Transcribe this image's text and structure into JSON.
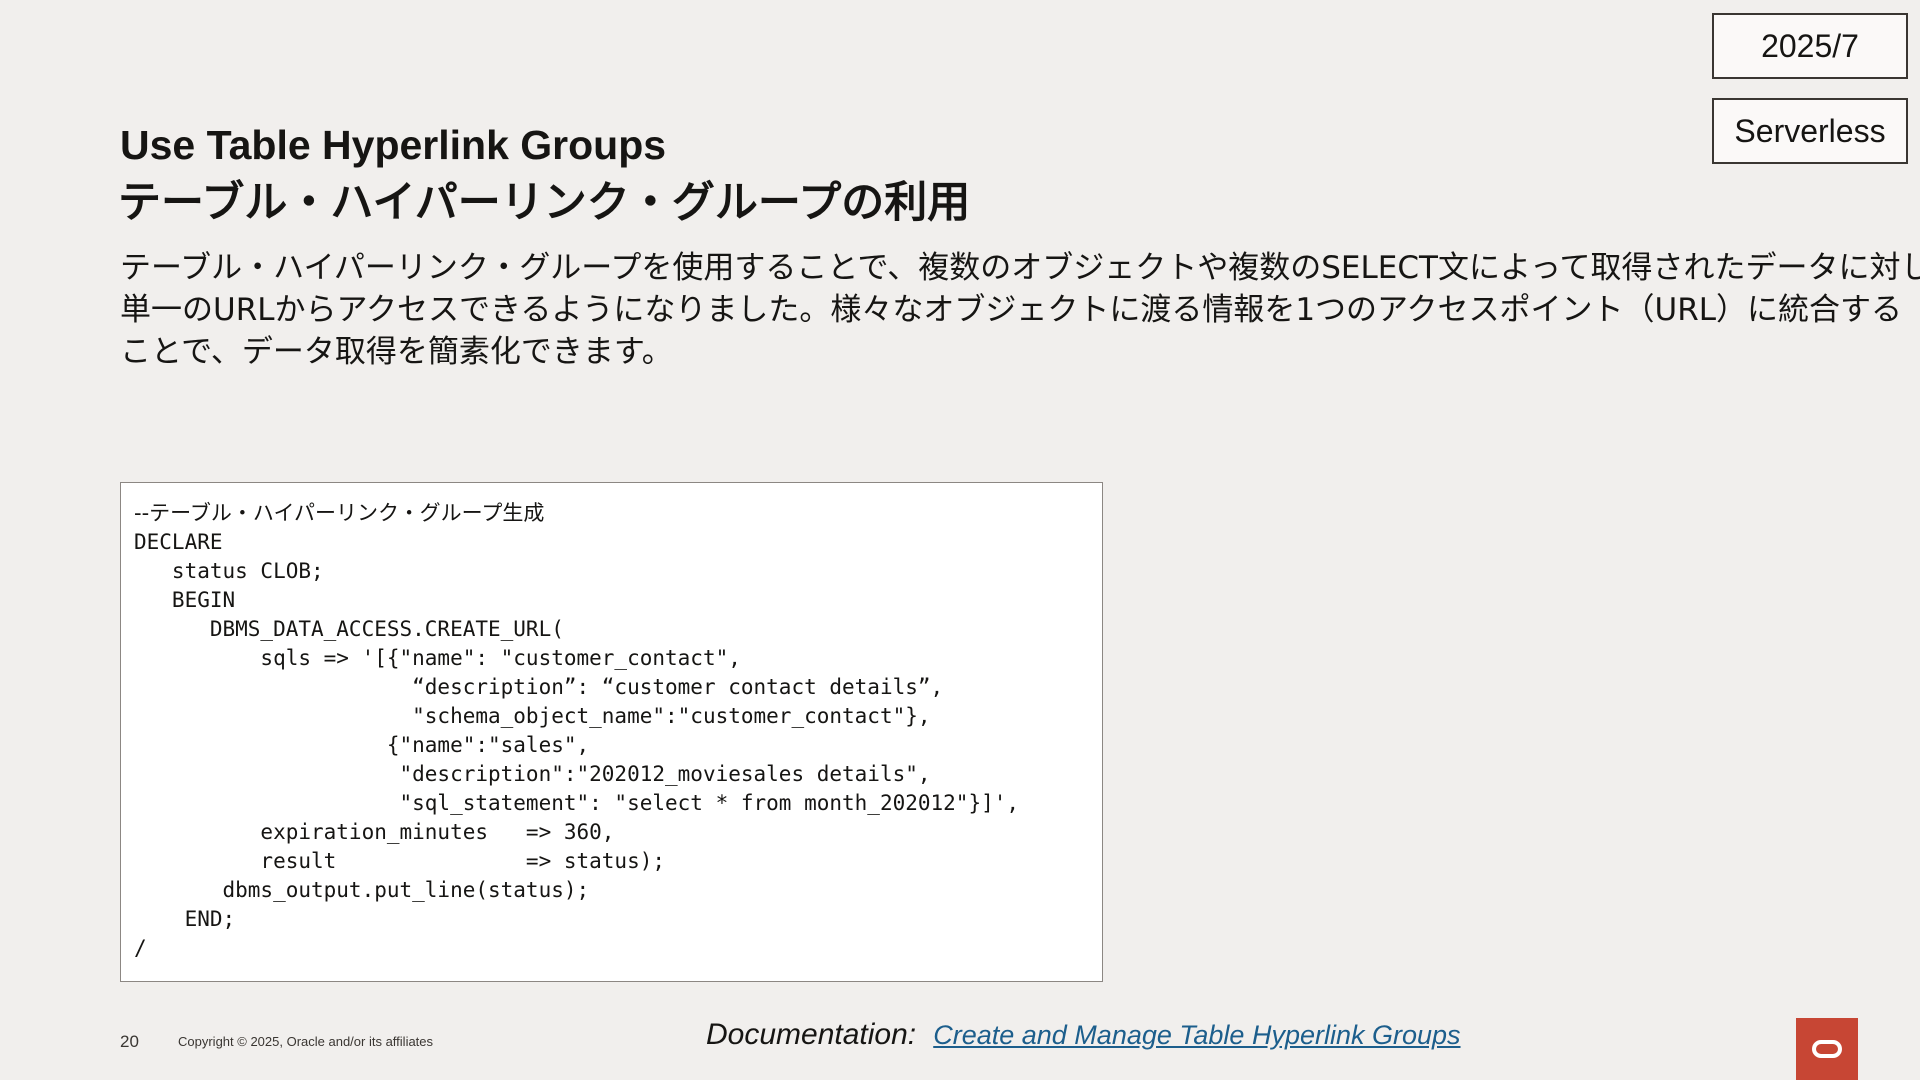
{
  "badges": {
    "date": "2025/7",
    "type": "Serverless"
  },
  "title": {
    "en": "Use Table Hyperlink Groups",
    "ja": "テーブル・ハイパーリンク・グループの利用"
  },
  "description": {
    "lines": [
      "テーブル・ハイパーリンク・グループを使用することで、複数のオブジェクトや複数のSELECT文によって取得されたデータに対し、",
      "単一のURLからアクセスできるようになりました。様々なオブジェクトに渡る情報を1つのアクセスポイント（URL）に統合する",
      "ことで、データ取得を簡素化できます。"
    ]
  },
  "code": {
    "lines": [
      "--テーブル・ハイパーリンク・グループ生成",
      "DECLARE",
      "   status CLOB;",
      "   BEGIN",
      "      DBMS_DATA_ACCESS.CREATE_URL(",
      "          sqls => '[{\"name\": \"customer_contact\",",
      "                      “description”: “customer contact details”,",
      "                      \"schema_object_name\":\"customer_contact\"},",
      "                    {\"name\":\"sales\",",
      "                     \"description\":\"202012_moviesales details\",",
      "                     \"sql_statement\": \"select * from month_202012\"}]',",
      "          expiration_minutes   => 360,",
      "          result               => status);",
      "       dbms_output.put_line(status);",
      "    END;",
      "/"
    ]
  },
  "footer": {
    "page_number": "20",
    "copyright": "Copyright © 2025, Oracle and/or its affiliates",
    "doc_label": "Documentation:",
    "doc_link": "Create and Manage Table Hyperlink Groups"
  },
  "colors": {
    "background": "#f1efed",
    "link": "#1c5e8c",
    "oracle_red": "#c74634"
  },
  "icons": {
    "logo": "oracle-logo-icon"
  }
}
